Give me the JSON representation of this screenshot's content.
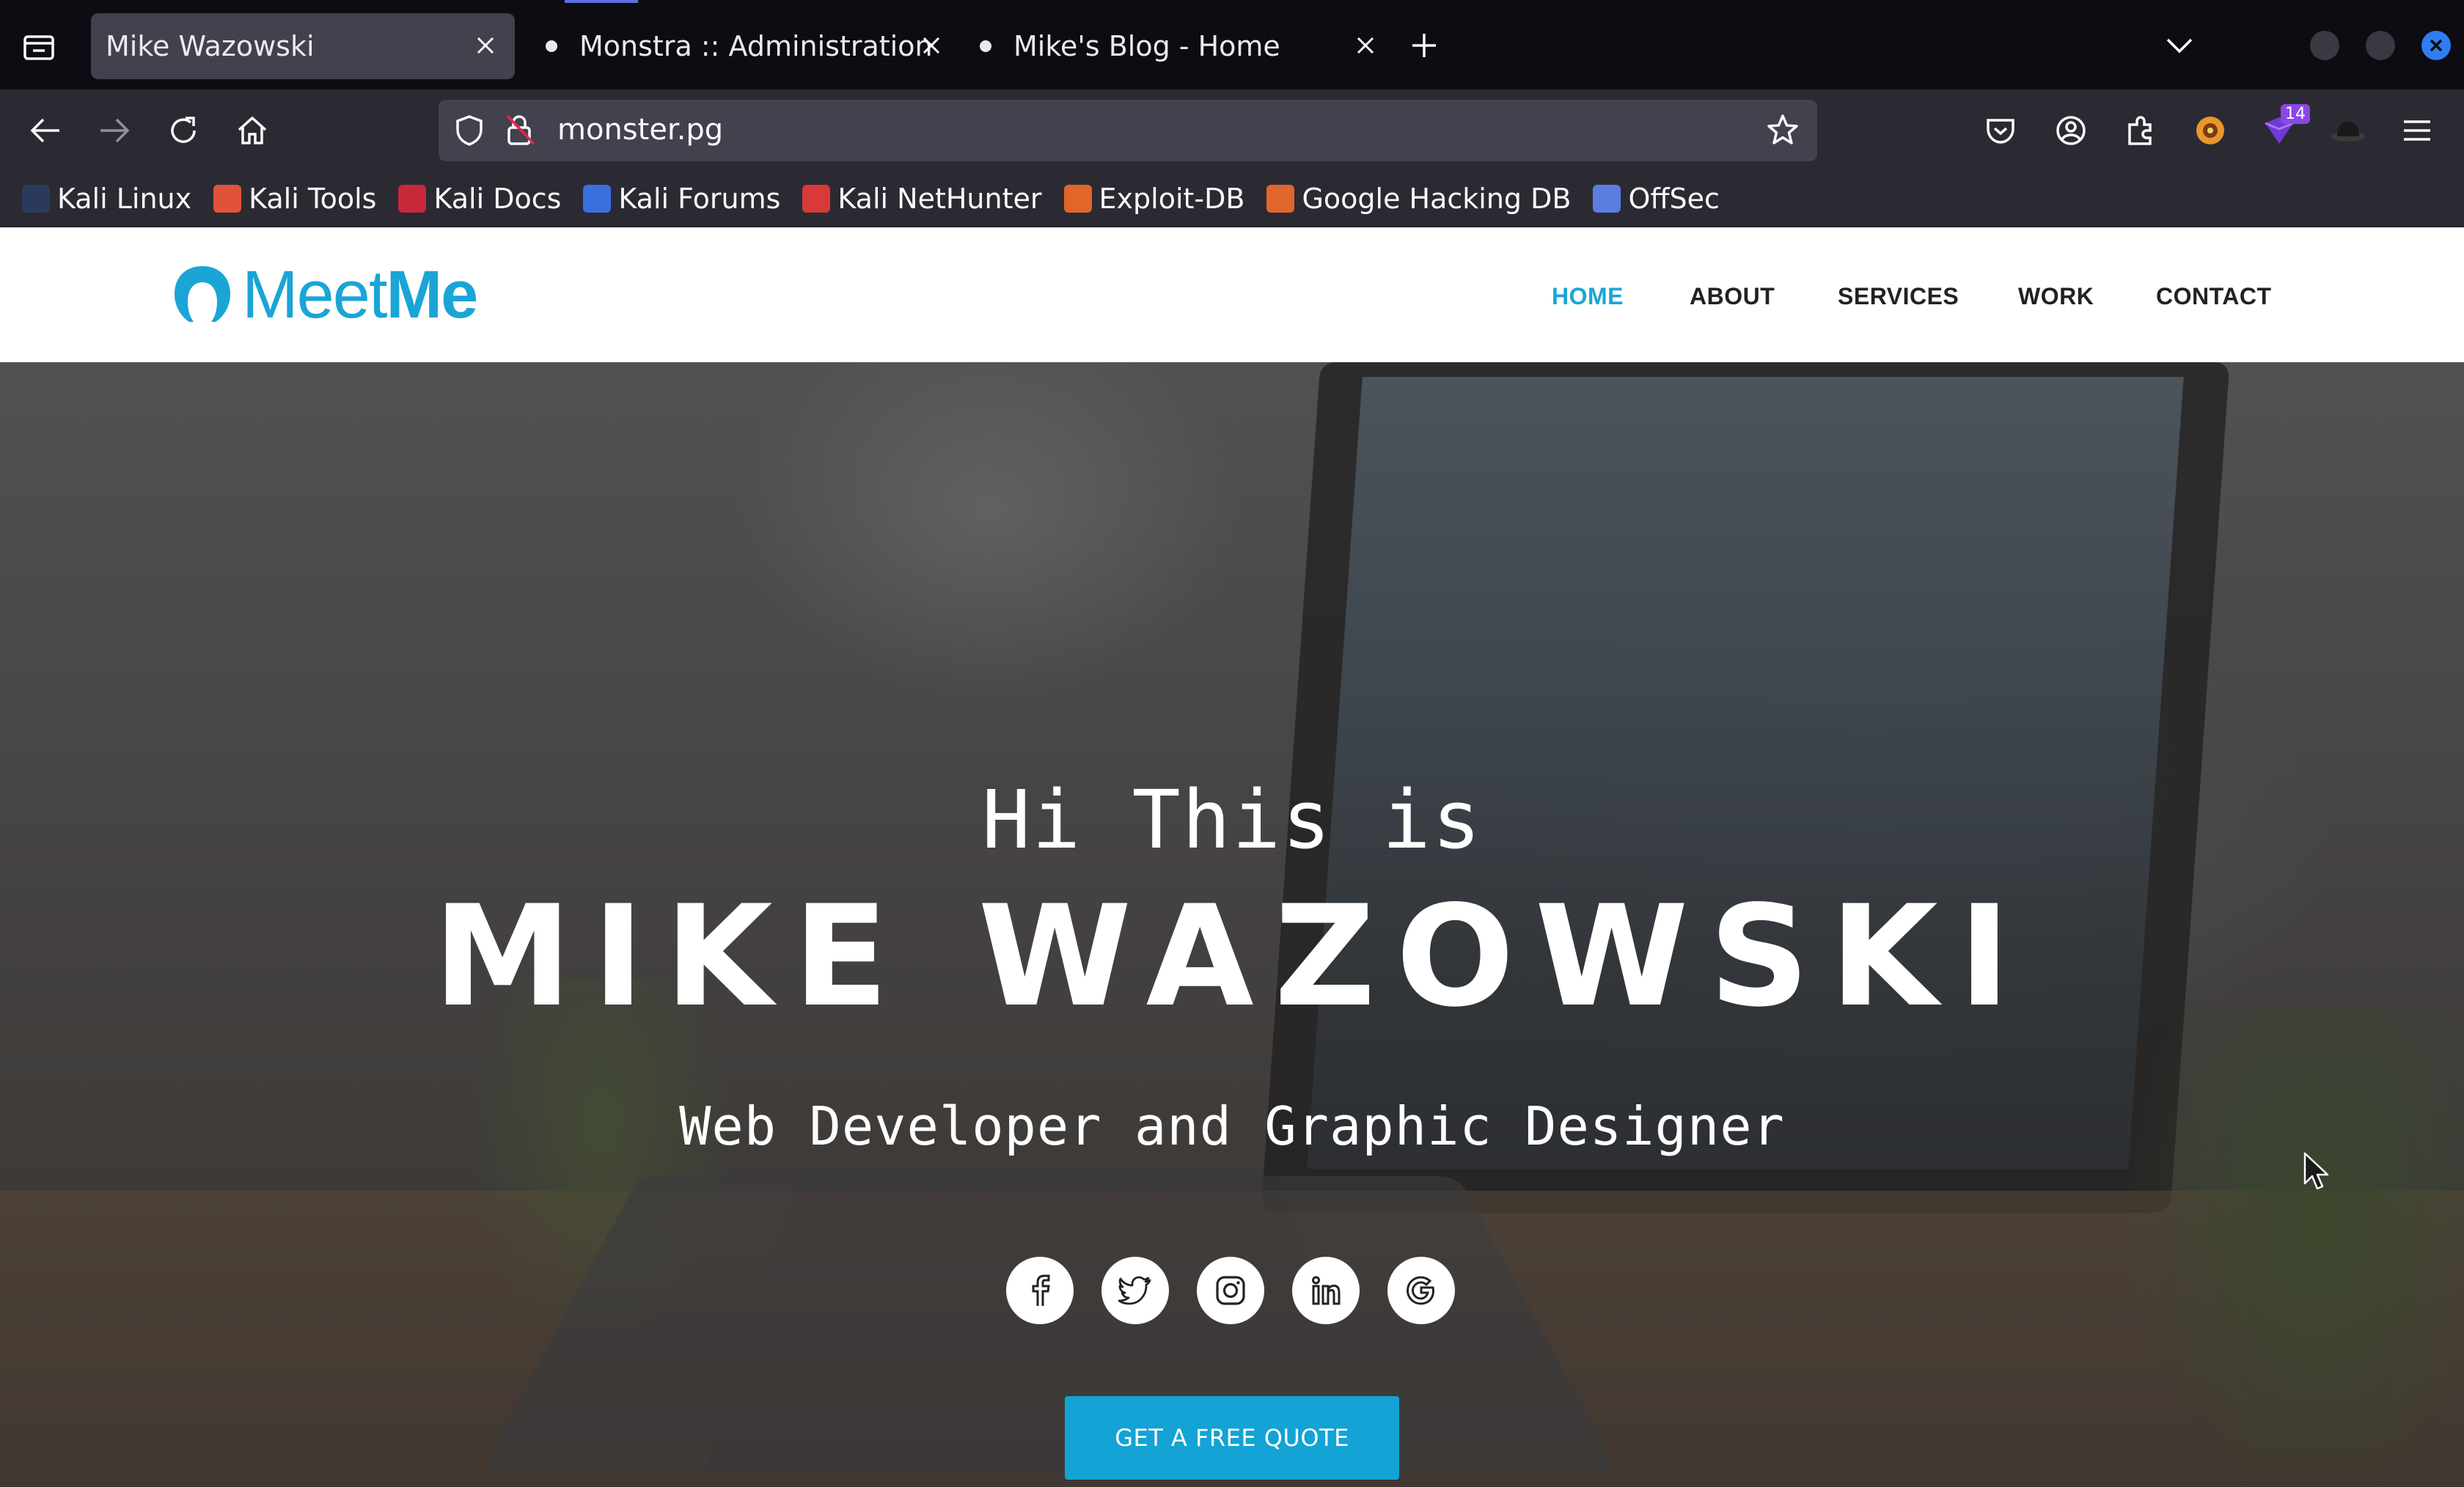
{
  "tabs": [
    {
      "label": "Mike Wazowski",
      "active": true
    },
    {
      "label": "Monstra :: Administration",
      "active": false
    },
    {
      "label": "Mike's Blog - Home",
      "active": false
    }
  ],
  "url": "monster.pg",
  "extension_badge": "14",
  "bookmarks": [
    {
      "label": "Kali Linux",
      "color": "#2b3a5a"
    },
    {
      "label": "Kali Tools",
      "color": "#e0533a"
    },
    {
      "label": "Kali Docs",
      "color": "#c9283a"
    },
    {
      "label": "Kali Forums",
      "color": "#3a6fe0"
    },
    {
      "label": "Kali NetHunter",
      "color": "#d83a3a"
    },
    {
      "label": "Exploit-DB",
      "color": "#e0662a"
    },
    {
      "label": "Google Hacking DB",
      "color": "#e0662a"
    },
    {
      "label": "OffSec",
      "color": "#5a7de0"
    }
  ],
  "site": {
    "logo": {
      "meet": "Meet",
      "me": "Me",
      "color": "#1aa5d6"
    },
    "nav": [
      {
        "label": "HOME",
        "active": true
      },
      {
        "label": "ABOUT",
        "active": false
      },
      {
        "label": "SERVICES",
        "active": false
      },
      {
        "label": "WORK",
        "active": false
      },
      {
        "label": "CONTACT",
        "active": false
      }
    ],
    "hero": {
      "greeting": "Hi This is",
      "name": "MIKE WAZOWSKI",
      "role": "Web Developer and Graphic Designer",
      "socials": [
        "facebook-icon",
        "twitter-icon",
        "instagram-icon",
        "linkedin-icon",
        "google-icon"
      ],
      "cta": "GET A FREE QUOTE",
      "cta_color": "#13a3d4"
    }
  }
}
